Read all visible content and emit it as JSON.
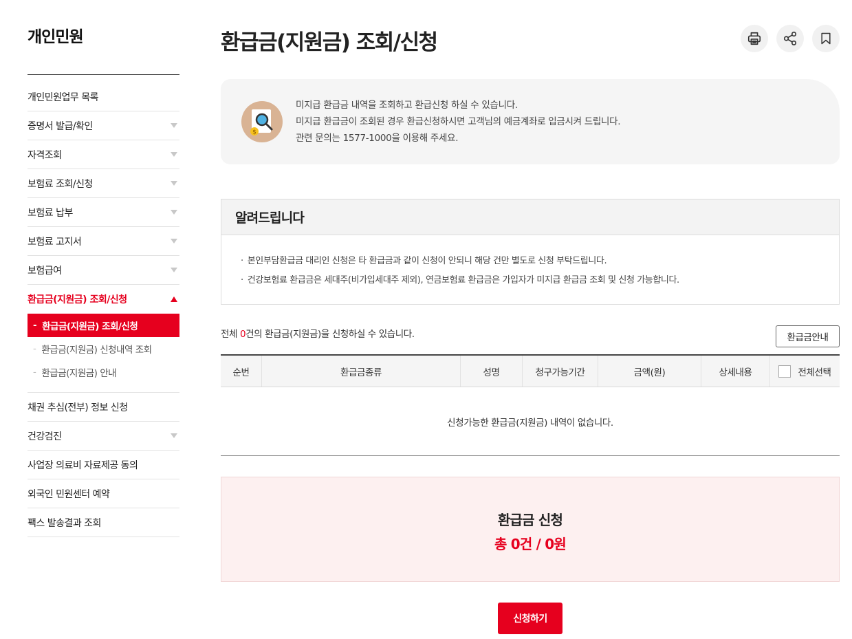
{
  "sidebar": {
    "title": "개인민원",
    "items": [
      {
        "label": "개인민원업무 목록",
        "has_caret": false
      },
      {
        "label": "증명서 발급/확인",
        "has_caret": true
      },
      {
        "label": "자격조회",
        "has_caret": true
      },
      {
        "label": "보험료 조회/신청",
        "has_caret": true
      },
      {
        "label": "보험료 납부",
        "has_caret": true
      },
      {
        "label": "보험료 고지서",
        "has_caret": true
      },
      {
        "label": "보험급여",
        "has_caret": true
      },
      {
        "label": "환급금(지원금) 조회/신청",
        "has_caret": true,
        "active": true
      },
      {
        "label": "채권 추심(전부) 정보 신청",
        "has_caret": false
      },
      {
        "label": "건강검진",
        "has_caret": true
      },
      {
        "label": "사업장 의료비 자료제공 동의",
        "has_caret": false
      },
      {
        "label": "외국인 민원센터 예약",
        "has_caret": false
      },
      {
        "label": "팩스 발송결과 조회",
        "has_caret": false
      }
    ],
    "subitems": [
      {
        "dash": "-",
        "label": "환급금(지원금) 조회/신청",
        "current": true
      },
      {
        "dash": "-",
        "label": "환급금(지원금) 신청내역 조회"
      },
      {
        "dash": "-",
        "label": "환급금(지원금) 안내"
      }
    ]
  },
  "header": {
    "title": "환급금(지원금) 조회/신청",
    "tools": [
      "print-icon",
      "share-icon",
      "bookmark-icon"
    ]
  },
  "intro": {
    "icon": "document-search-icon",
    "lines": [
      "미지급 환급금 내역을 조회하고 환급신청 하실 수 있습니다.",
      "미지급 환급금이 조회된 경우 환급신청하시면 고객님의 예금계좌로 입금시켜 드립니다.",
      "관련 문의는 1577-1000을 이용해 주세요."
    ]
  },
  "notice": {
    "title": "알려드립니다",
    "bullet": "·",
    "items": [
      "본인부담환급금 대리인 신청은 타 환급금과 같이 신청이 안되니 해당 건만 별도로 신청 부탁드립니다.",
      "건강보험료 환급금은 세대주(비가입세대주 제외), 연금보험료 환급금은 가입자가 미지급 환급금 조회 및 신청 가능합니다."
    ]
  },
  "summary": {
    "prefix": "전체 ",
    "count": "0",
    "suffix": "건의 환급금(지원금)을 신청하실 수 있습니다.",
    "guide_button": "환급금안내"
  },
  "table": {
    "columns": [
      "순번",
      "환급금종류",
      "성명",
      "청구가능기간",
      "금액(원)",
      "상세내용",
      "전체선택"
    ],
    "empty_message": "신청가능한 환급금(지원금) 내역이 없습니다."
  },
  "apply": {
    "title": "환급금 신청",
    "total": "총 0건 / 0원",
    "submit": "신청하기"
  },
  "colors": {
    "accent": "#e6001e",
    "apply_bg": "#fdf0f0",
    "intro_bg": "#f5f5f5"
  }
}
